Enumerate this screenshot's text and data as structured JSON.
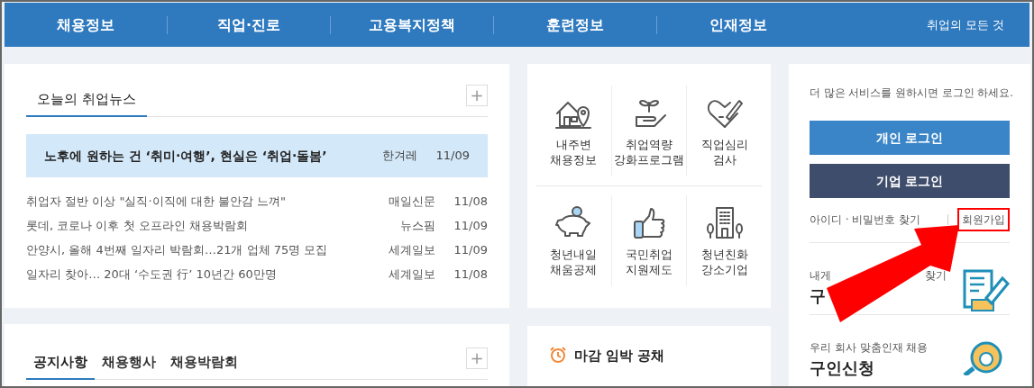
{
  "nav": {
    "items": [
      "채용정보",
      "직업·진로",
      "고용복지정책",
      "훈련정보",
      "인재정보"
    ],
    "tagline": "취업의 모든 것"
  },
  "news": {
    "tabs": [
      {
        "label": "오늘의 취업뉴스",
        "selected": true
      }
    ],
    "more": "+",
    "headline": {
      "title": "노후에 원하는 건 ‘취미·여행’, 현실은 ‘취업·돌봄’",
      "source": "한겨레",
      "date": "11/09"
    },
    "items": [
      {
        "title": "취업자 절반 이상 \"실직·이직에 대한 불안감 느껴\"",
        "source": "매일신문",
        "date": "11/08"
      },
      {
        "title": "롯데, 코로나 이후 첫 오프라인 채용박람회",
        "source": "뉴스핌",
        "date": "11/09"
      },
      {
        "title": "안양시, 올해 4번째 일자리 박람회…21개 업체 75명 모집",
        "source": "세계일보",
        "date": "11/09"
      },
      {
        "title": "일자리 찾아… 20대 ‘수도권 行’ 10년간 60만명",
        "source": "세계일보",
        "date": "11/08"
      }
    ]
  },
  "notice": {
    "tabs": [
      {
        "label": "공지사항",
        "selected": true
      },
      {
        "label": "채용행사",
        "selected": false
      },
      {
        "label": "채용박람회",
        "selected": false
      }
    ],
    "more": "+"
  },
  "services": [
    {
      "kind": "house",
      "lines": [
        "내주변",
        "채용정보"
      ]
    },
    {
      "kind": "sprout",
      "lines": [
        "취업역량",
        "강화프로그램"
      ]
    },
    {
      "kind": "heart",
      "lines": [
        "직업심리",
        "검사"
      ]
    },
    {
      "kind": "piggy",
      "lines": [
        "청년내일",
        "채움공제"
      ]
    },
    {
      "kind": "thumb",
      "lines": [
        "국민취업",
        "지원제도"
      ]
    },
    {
      "kind": "building",
      "lines": [
        "청년친화",
        "강소기업"
      ]
    }
  ],
  "deadline": {
    "title": "마감 임박 공채"
  },
  "login": {
    "prompt": "더 많은 서비스를 원하시면 로그인 하세요.",
    "buttons": [
      {
        "kind": "personal",
        "label": "개인 로그인"
      },
      {
        "kind": "company",
        "label": "기업 로그인"
      }
    ],
    "find": "아이디 · 비밀번호 찾기",
    "signup": {
      "label": "회원가입",
      "highlighted": true
    }
  },
  "promos": [
    {
      "kind": "resume",
      "subtitle": [
        "내게",
        "찾기"
      ],
      "title": [
        "구"
      ]
    },
    {
      "kind": "search",
      "subtitle": [
        "우리 회사 맞춤인재 채용"
      ],
      "title": [
        "구인신청"
      ]
    }
  ],
  "annotation": {
    "arrow": true
  }
}
